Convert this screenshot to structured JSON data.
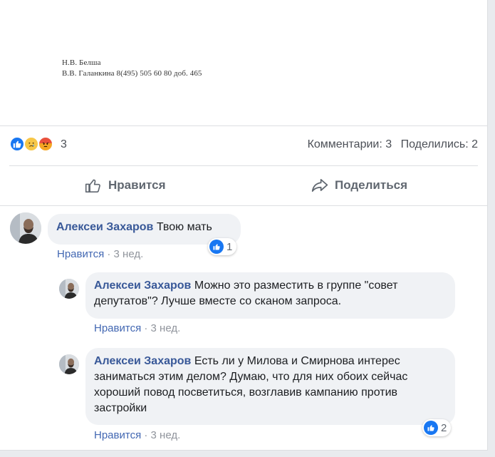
{
  "post": {
    "doc_lines": [
      "Н.В. Белша",
      "В.В. Галанкина 8(495) 505 60 80 доб. 465"
    ],
    "reaction_count": "3",
    "comments_count": "Комментарии: 3",
    "shares_count": "Поделились: 2",
    "like_button": "Нравится",
    "share_button": "Поделиться"
  },
  "comments": [
    {
      "author": "Алексеи Захаров",
      "text": "Твою мать",
      "like_label": "Нравится",
      "separator": "·",
      "time": "3 нед.",
      "likes": "1"
    },
    {
      "author": "Алексеи Захаров",
      "text_line1": "Можно это разместить в группе \"совет",
      "text_line2": "депутатов\"? Лучше вместе со сканом запроса.",
      "like_label": "Нравится",
      "separator": "·",
      "time": "3 нед."
    },
    {
      "author": "Алексеи Захаров",
      "text_line1": "Есть ли у Милова и Смирнова интерес",
      "text_line2": "заниматься этим делом? Думаю, что для них обоих сейчас",
      "text_line3": "хороший повод посветиться, возглавив кампанию против",
      "text_line4": "застройки",
      "like_label": "Нравится",
      "separator": "·",
      "time": "3 нед.",
      "likes": "2"
    }
  ],
  "colors": {
    "link": "#385898",
    "like_blue": "#1877f2",
    "muted": "#90949c",
    "bubble": "#f0f2f5"
  }
}
